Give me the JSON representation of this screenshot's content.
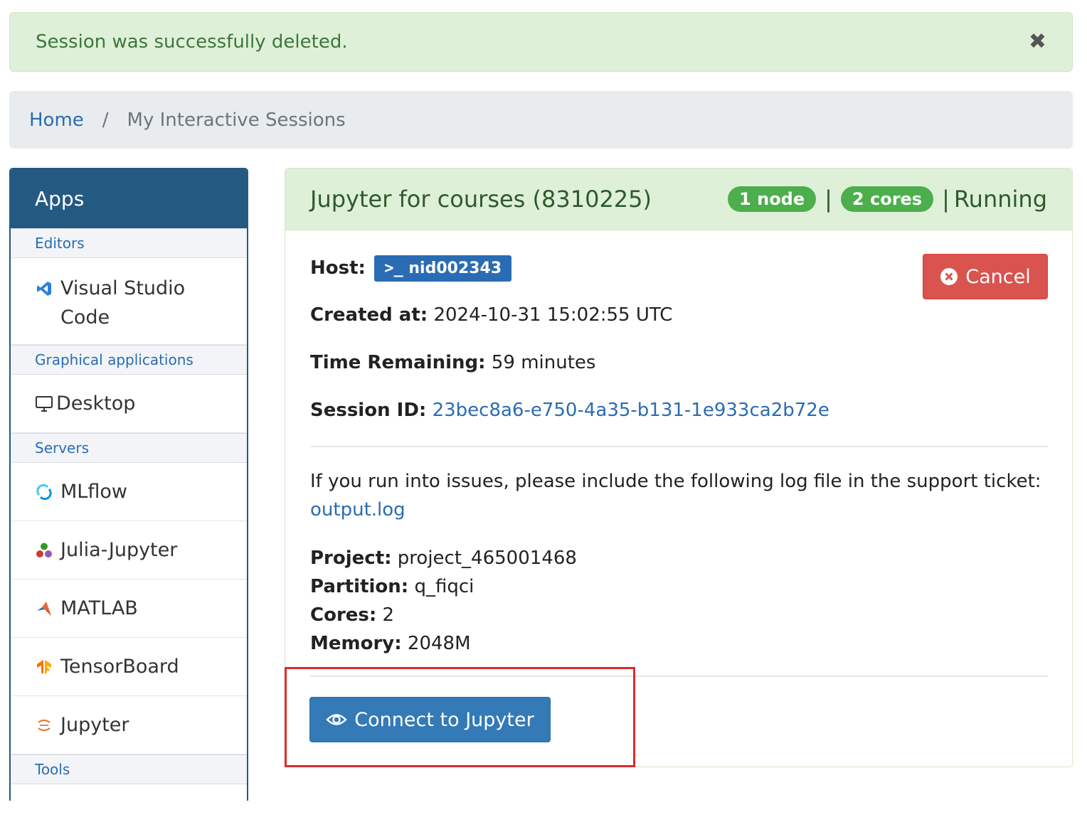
{
  "alert": {
    "message": "Session was successfully deleted.",
    "close_glyph": "✖"
  },
  "breadcrumb": {
    "home": "Home",
    "separator": "/",
    "current": "My Interactive Sessions"
  },
  "sidebar": {
    "title": "Apps",
    "categories": {
      "editors": "Editors",
      "graphical": "Graphical applications",
      "servers": "Servers",
      "tools": "Tools"
    },
    "items": {
      "vscode": "Visual Studio Code",
      "desktop": "Desktop",
      "mlflow": "MLflow",
      "julia": "Julia-Jupyter",
      "matlab": "MATLAB",
      "tensorboard": "TensorBoard",
      "jupyter": "Jupyter"
    }
  },
  "session": {
    "title": "Jupyter for courses (8310225)",
    "nodes_badge": "1 node",
    "cores_badge": "2 cores",
    "separator": "|",
    "state": "Running",
    "host_label": "Host:",
    "host": "nid002343",
    "created_label": "Created at:",
    "created": "2024-10-31 15:02:55 UTC",
    "remaining_label": "Time Remaining:",
    "remaining": "59 minutes",
    "session_id_label": "Session ID:",
    "session_id": "23bec8a6-e750-4a35-b131-1e933ca2b72e",
    "support_text": "If you run into issues, please include the following log file in the support ticket:",
    "log_link": "output.log",
    "project_label": "Project:",
    "project": "project_465001468",
    "partition_label": "Partition:",
    "partition": "q_fiqci",
    "cores_label": "Cores:",
    "cores": "2",
    "memory_label": "Memory:",
    "memory": "2048M",
    "cancel_label": "Cancel",
    "connect_label": "Connect to Jupyter"
  },
  "colors": {
    "accent_blue": "#337ab7",
    "sidebar_header": "#245a82",
    "success_bg": "#dff0d8",
    "danger": "#d9534f",
    "badge_green": "#4cae4c",
    "highlight": "#e02a2a"
  },
  "icons": {
    "alert_close": "close-icon",
    "vscode": "vscode-icon",
    "desktop": "monitor-icon",
    "mlflow": "mlflow-icon",
    "julia": "julia-icon",
    "matlab": "matlab-icon",
    "tensorboard": "tensorflow-icon",
    "jupyter": "jupyter-icon",
    "host": "terminal-icon",
    "cancel": "times-circle-icon",
    "connect": "eye-icon"
  }
}
